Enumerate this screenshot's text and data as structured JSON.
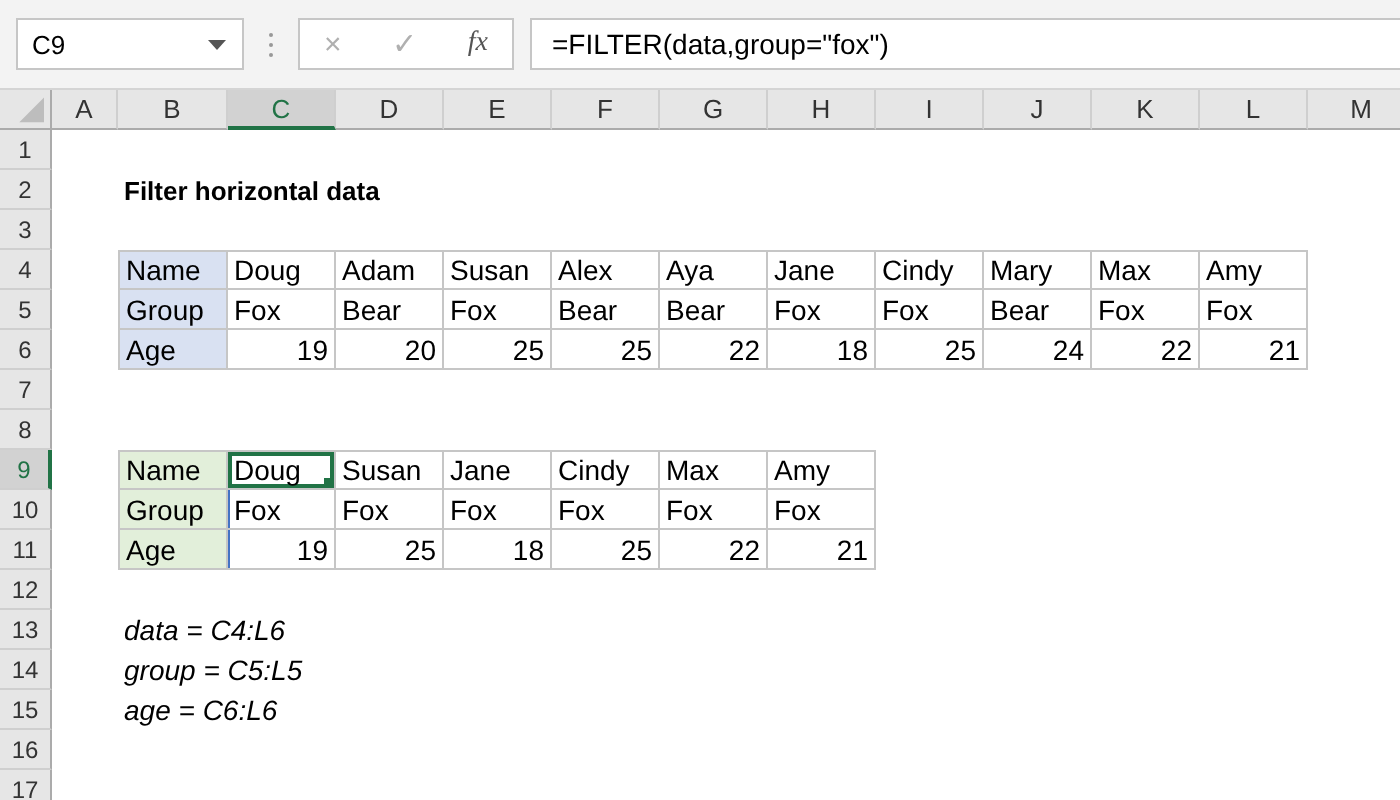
{
  "name_box": "C9",
  "formula_buttons": [
    "×",
    "✓",
    "fx"
  ],
  "formula": "=FILTER(data,group=\"fox\")",
  "columns": [
    {
      "label": "A",
      "selected": false
    },
    {
      "label": "B",
      "selected": false
    },
    {
      "label": "C",
      "selected": true
    },
    {
      "label": "D",
      "selected": false
    },
    {
      "label": "E",
      "selected": false
    },
    {
      "label": "F",
      "selected": false
    },
    {
      "label": "G",
      "selected": false
    },
    {
      "label": "H",
      "selected": false
    },
    {
      "label": "I",
      "selected": false
    },
    {
      "label": "J",
      "selected": false
    },
    {
      "label": "K",
      "selected": false
    },
    {
      "label": "L",
      "selected": false
    },
    {
      "label": "M",
      "selected": false
    }
  ],
  "rows": [
    {
      "label": "1",
      "selected": false
    },
    {
      "label": "2",
      "selected": false
    },
    {
      "label": "3",
      "selected": false
    },
    {
      "label": "4",
      "selected": false
    },
    {
      "label": "5",
      "selected": false
    },
    {
      "label": "6",
      "selected": false
    },
    {
      "label": "7",
      "selected": false
    },
    {
      "label": "8",
      "selected": false
    },
    {
      "label": "9",
      "selected": true
    },
    {
      "label": "10",
      "selected": false
    },
    {
      "label": "11",
      "selected": false
    },
    {
      "label": "12",
      "selected": false
    },
    {
      "label": "13",
      "selected": false
    },
    {
      "label": "14",
      "selected": false
    },
    {
      "label": "15",
      "selected": false
    },
    {
      "label": "16",
      "selected": false
    },
    {
      "label": "17",
      "selected": false
    }
  ],
  "title": "Filter horizontal data",
  "source_table": {
    "rows": [
      {
        "label": "Name",
        "kind": "text",
        "values": [
          {
            "text": "Doug"
          },
          {
            "text": "Adam"
          },
          {
            "text": "Susan"
          },
          {
            "text": "Alex"
          },
          {
            "text": "Aya"
          },
          {
            "text": "Jane"
          },
          {
            "text": "Cindy"
          },
          {
            "text": "Mary"
          },
          {
            "text": "Max"
          },
          {
            "text": "Amy"
          }
        ]
      },
      {
        "label": "Group",
        "kind": "text",
        "values": [
          {
            "text": "Fox"
          },
          {
            "text": "Bear"
          },
          {
            "text": "Fox"
          },
          {
            "text": "Bear"
          },
          {
            "text": "Bear"
          },
          {
            "text": "Fox"
          },
          {
            "text": "Fox"
          },
          {
            "text": "Bear"
          },
          {
            "text": "Fox"
          },
          {
            "text": "Fox"
          }
        ]
      },
      {
        "label": "Age",
        "kind": "number",
        "values": [
          {
            "text": "19"
          },
          {
            "text": "20"
          },
          {
            "text": "25"
          },
          {
            "text": "25"
          },
          {
            "text": "22"
          },
          {
            "text": "18"
          },
          {
            "text": "25"
          },
          {
            "text": "24"
          },
          {
            "text": "22"
          },
          {
            "text": "21"
          }
        ]
      }
    ]
  },
  "result_table": {
    "rows": [
      {
        "label": "Name",
        "kind": "text",
        "values": [
          {
            "text": "Doug",
            "selected": true
          },
          {
            "text": "Susan",
            "selected": false
          },
          {
            "text": "Jane",
            "selected": false
          },
          {
            "text": "Cindy",
            "selected": false
          },
          {
            "text": "Max",
            "selected": false
          },
          {
            "text": "Amy",
            "selected": false
          }
        ]
      },
      {
        "label": "Group",
        "kind": "text",
        "values": [
          {
            "text": "Fox",
            "selected": false
          },
          {
            "text": "Fox",
            "selected": false
          },
          {
            "text": "Fox",
            "selected": false
          },
          {
            "text": "Fox",
            "selected": false
          },
          {
            "text": "Fox",
            "selected": false
          },
          {
            "text": "Fox",
            "selected": false
          }
        ]
      },
      {
        "label": "Age",
        "kind": "number",
        "values": [
          {
            "text": "19",
            "selected": false
          },
          {
            "text": "25",
            "selected": false
          },
          {
            "text": "18",
            "selected": false
          },
          {
            "text": "25",
            "selected": false
          },
          {
            "text": "22",
            "selected": false
          },
          {
            "text": "21",
            "selected": false
          }
        ]
      }
    ]
  },
  "notes": [
    "data = C4:L6",
    "group = C5:L5",
    "age = C6:L6"
  ]
}
